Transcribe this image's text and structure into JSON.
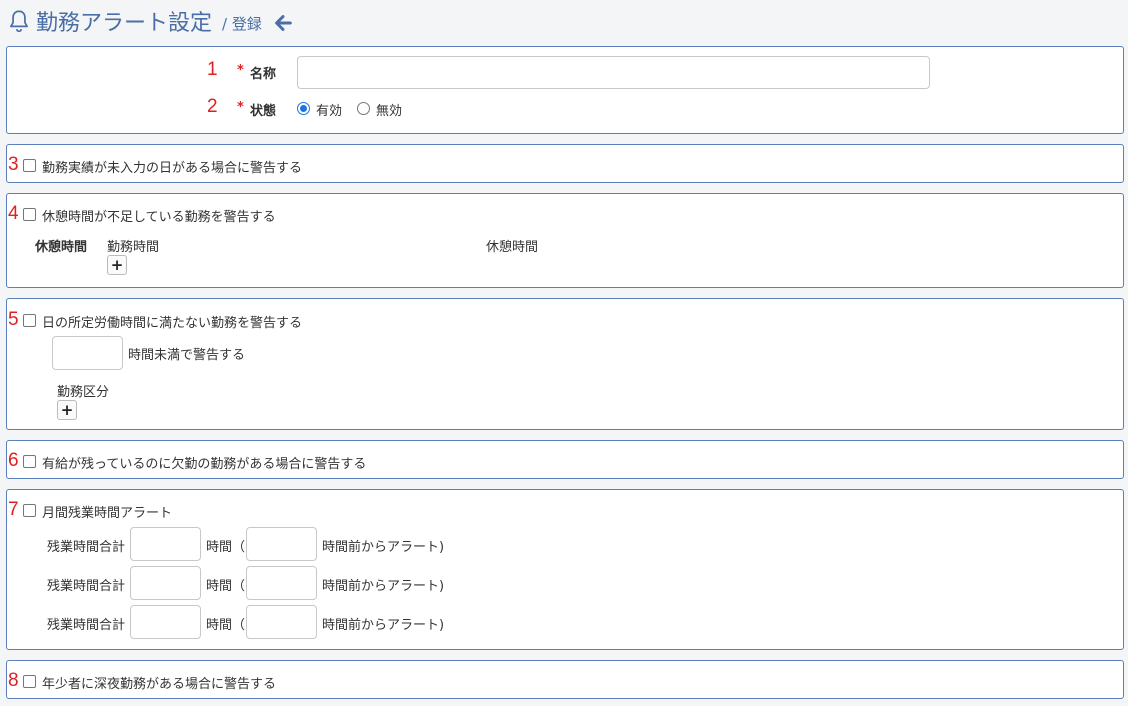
{
  "header": {
    "title": "勤務アラート設定",
    "subtitle": "/ 登録"
  },
  "colors": {
    "accent": "#4a6ea5",
    "required": "#e02020",
    "border": "#5b7fbd"
  },
  "section1": {
    "num_name": "1",
    "num_status": "2",
    "required_mark": "*",
    "name_label": "名称",
    "name_value": "",
    "status_label": "状態",
    "status_options": [
      "有効",
      "無効"
    ],
    "status_selected": "有効"
  },
  "section3": {
    "num": "3",
    "label": "勤務実績が未入力の日がある場合に警告する"
  },
  "section4": {
    "num": "4",
    "label": "休憩時間が不足している勤務を警告する",
    "sub_title": "休憩時間",
    "col_work": "勤務時間",
    "col_break": "休憩時間",
    "add_label": "+"
  },
  "section5": {
    "num": "5",
    "label": "日の所定労働時間に満たない勤務を警告する",
    "hours_value": "",
    "hours_suffix": "時間未満で警告する",
    "work_type_label": "勤務区分",
    "add_label": "+"
  },
  "section6": {
    "num": "6",
    "label": "有給が残っているのに欠勤の勤務がある場合に警告する"
  },
  "section7": {
    "num": "7",
    "label": "月間残業時間アラート",
    "rows": [
      {
        "label": "残業時間合計",
        "hours_text": "時間（",
        "tail": "時間前からアラート)",
        "value1": "",
        "value2": ""
      },
      {
        "label": "残業時間合計",
        "hours_text": "時間（",
        "tail": "時間前からアラート)",
        "value1": "",
        "value2": ""
      },
      {
        "label": "残業時間合計",
        "hours_text": "時間（",
        "tail": "時間前からアラート)",
        "value1": "",
        "value2": ""
      }
    ]
  },
  "section8": {
    "num": "8",
    "label": "年少者に深夜勤務がある場合に警告する"
  }
}
